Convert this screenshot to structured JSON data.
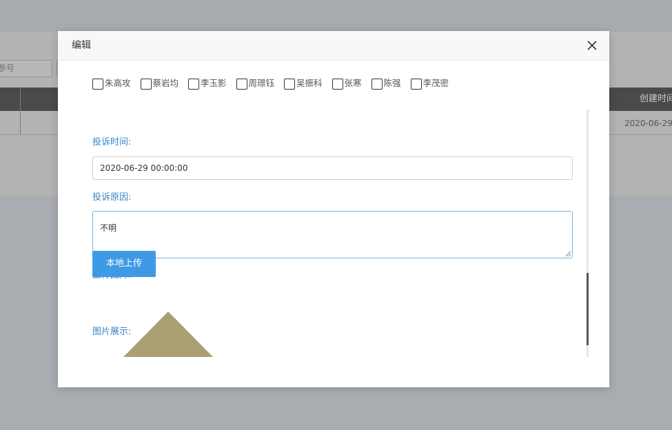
{
  "background": {
    "search_placeholder": "参号",
    "table_header_label": "创建时间",
    "table_row_value": "2020-06-29"
  },
  "modal": {
    "title": "编辑",
    "close_icon": "close-icon",
    "people_checkboxes": [
      {
        "label": "朱高攻",
        "checked": false
      },
      {
        "label": "蔡岩均",
        "checked": false
      },
      {
        "label": "李玉影",
        "checked": false
      },
      {
        "label": "周璟钰",
        "checked": false
      },
      {
        "label": "吴振科",
        "checked": false
      },
      {
        "label": "张寒",
        "checked": false
      },
      {
        "label": "陈强",
        "checked": false
      },
      {
        "label": "李茂密",
        "checked": false
      }
    ],
    "complaint_time": {
      "label": "投诉时间:",
      "value": "2020-06-29 00:00:00"
    },
    "complaint_reason": {
      "label": "投诉原因:",
      "value": "不明"
    },
    "upload": {
      "label": "上传图片:",
      "button_label": "本地上传"
    },
    "preview": {
      "label": "图片展示:"
    }
  },
  "colors": {
    "accent_label": "#3a84c4",
    "button_bg": "#3f9ae6",
    "image_shape": "#ad9f74"
  }
}
